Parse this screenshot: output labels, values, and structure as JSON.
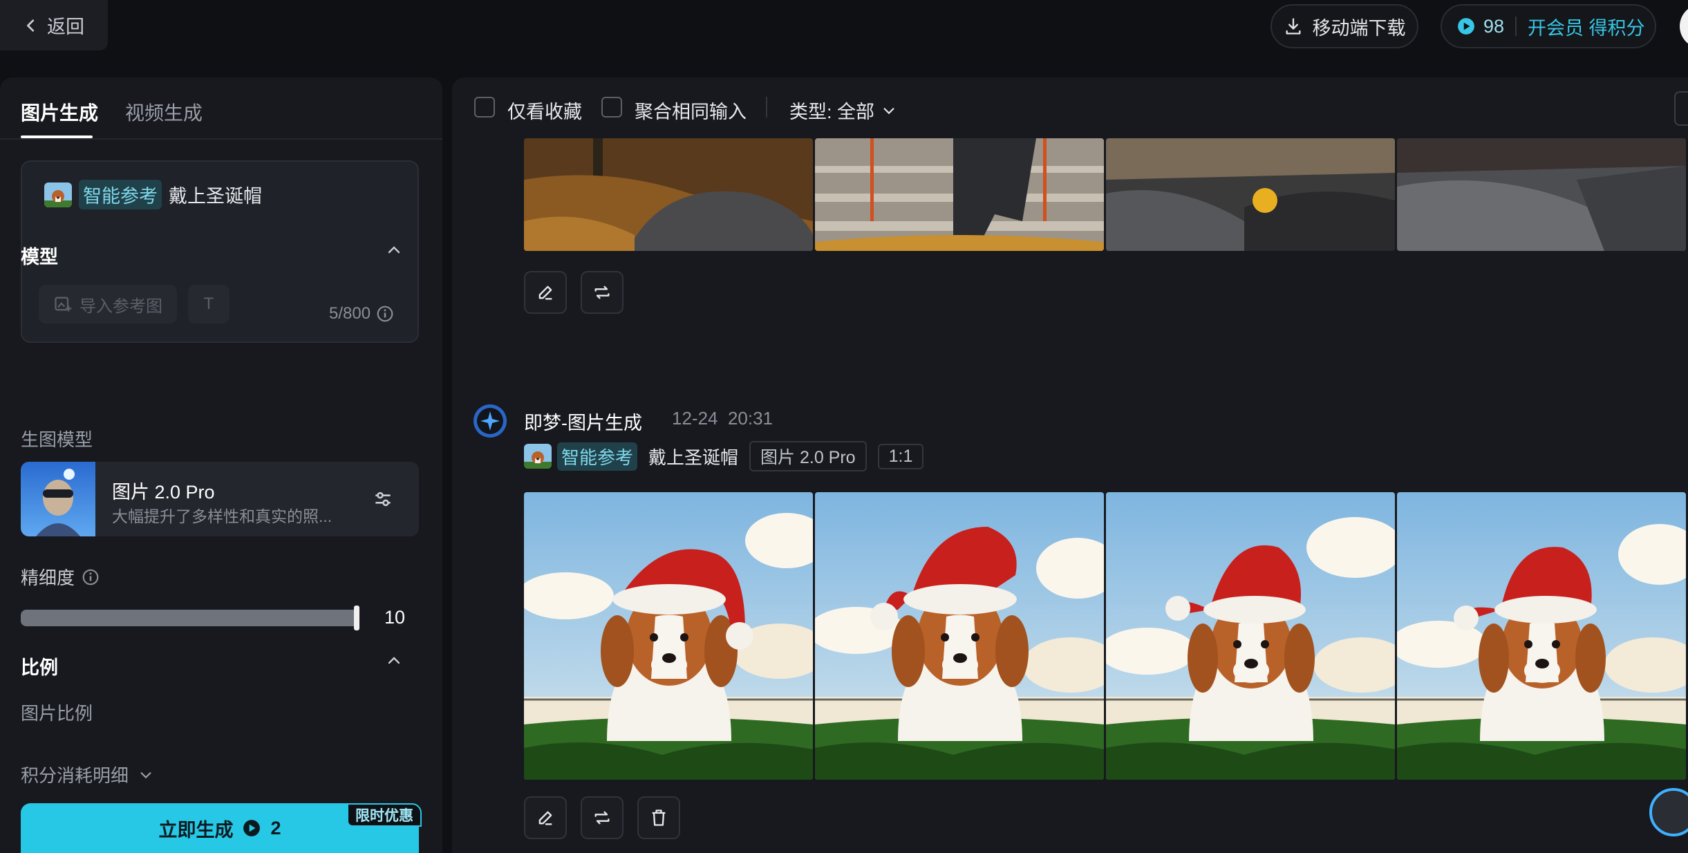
{
  "topbar": {
    "back_label": "返回",
    "download_label": "移动端下载",
    "points": "98",
    "vip_label": "开会员 得积分"
  },
  "left_panel": {
    "tabs": [
      {
        "label": "图片生成",
        "active": true
      },
      {
        "label": "视频生成",
        "active": false
      }
    ],
    "prompt": {
      "smart_ref_chip": "智能参考",
      "text": "戴上圣诞帽",
      "import_label": "导入参考图",
      "text_tool_icon": "T",
      "counter": "5/800"
    },
    "model_section": {
      "title": "模型",
      "subtitle": "生图模型",
      "model_name": "图片 2.0 Pro",
      "model_desc": "大幅提升了多样性和真实的照..."
    },
    "precision": {
      "label": "精细度",
      "value": "10"
    },
    "ratio_section": {
      "title": "比例",
      "subtitle": "图片比例"
    },
    "credits_detail": "积分消耗明细",
    "generate": {
      "label": "立即生成",
      "cost": "2",
      "promo_badge": "限时优惠"
    }
  },
  "main": {
    "toolbar": {
      "favorites_only": "仅看收藏",
      "merge_same_input": "聚合相同输入",
      "type_filter": "类型: 全部"
    },
    "generation": {
      "title": "即梦-图片生成",
      "date": "12-24",
      "time": "20:31",
      "smart_ref_chip": "智能参考",
      "prompt_text": "戴上圣诞帽",
      "model_tag": "图片 2.0 Pro",
      "ratio_tag": "1:1"
    }
  },
  "colors": {
    "accent": "#27c8e6",
    "background": "#0f1014",
    "panel": "#17191e"
  },
  "icons": [
    "chevron-left-icon",
    "download-icon",
    "coin-icon",
    "image-import-icon",
    "text-icon",
    "info-icon",
    "chevron-up-icon",
    "settings-sliders-icon",
    "chevron-down-icon",
    "edit-icon",
    "regenerate-icon",
    "delete-icon",
    "app-logo-icon"
  ]
}
